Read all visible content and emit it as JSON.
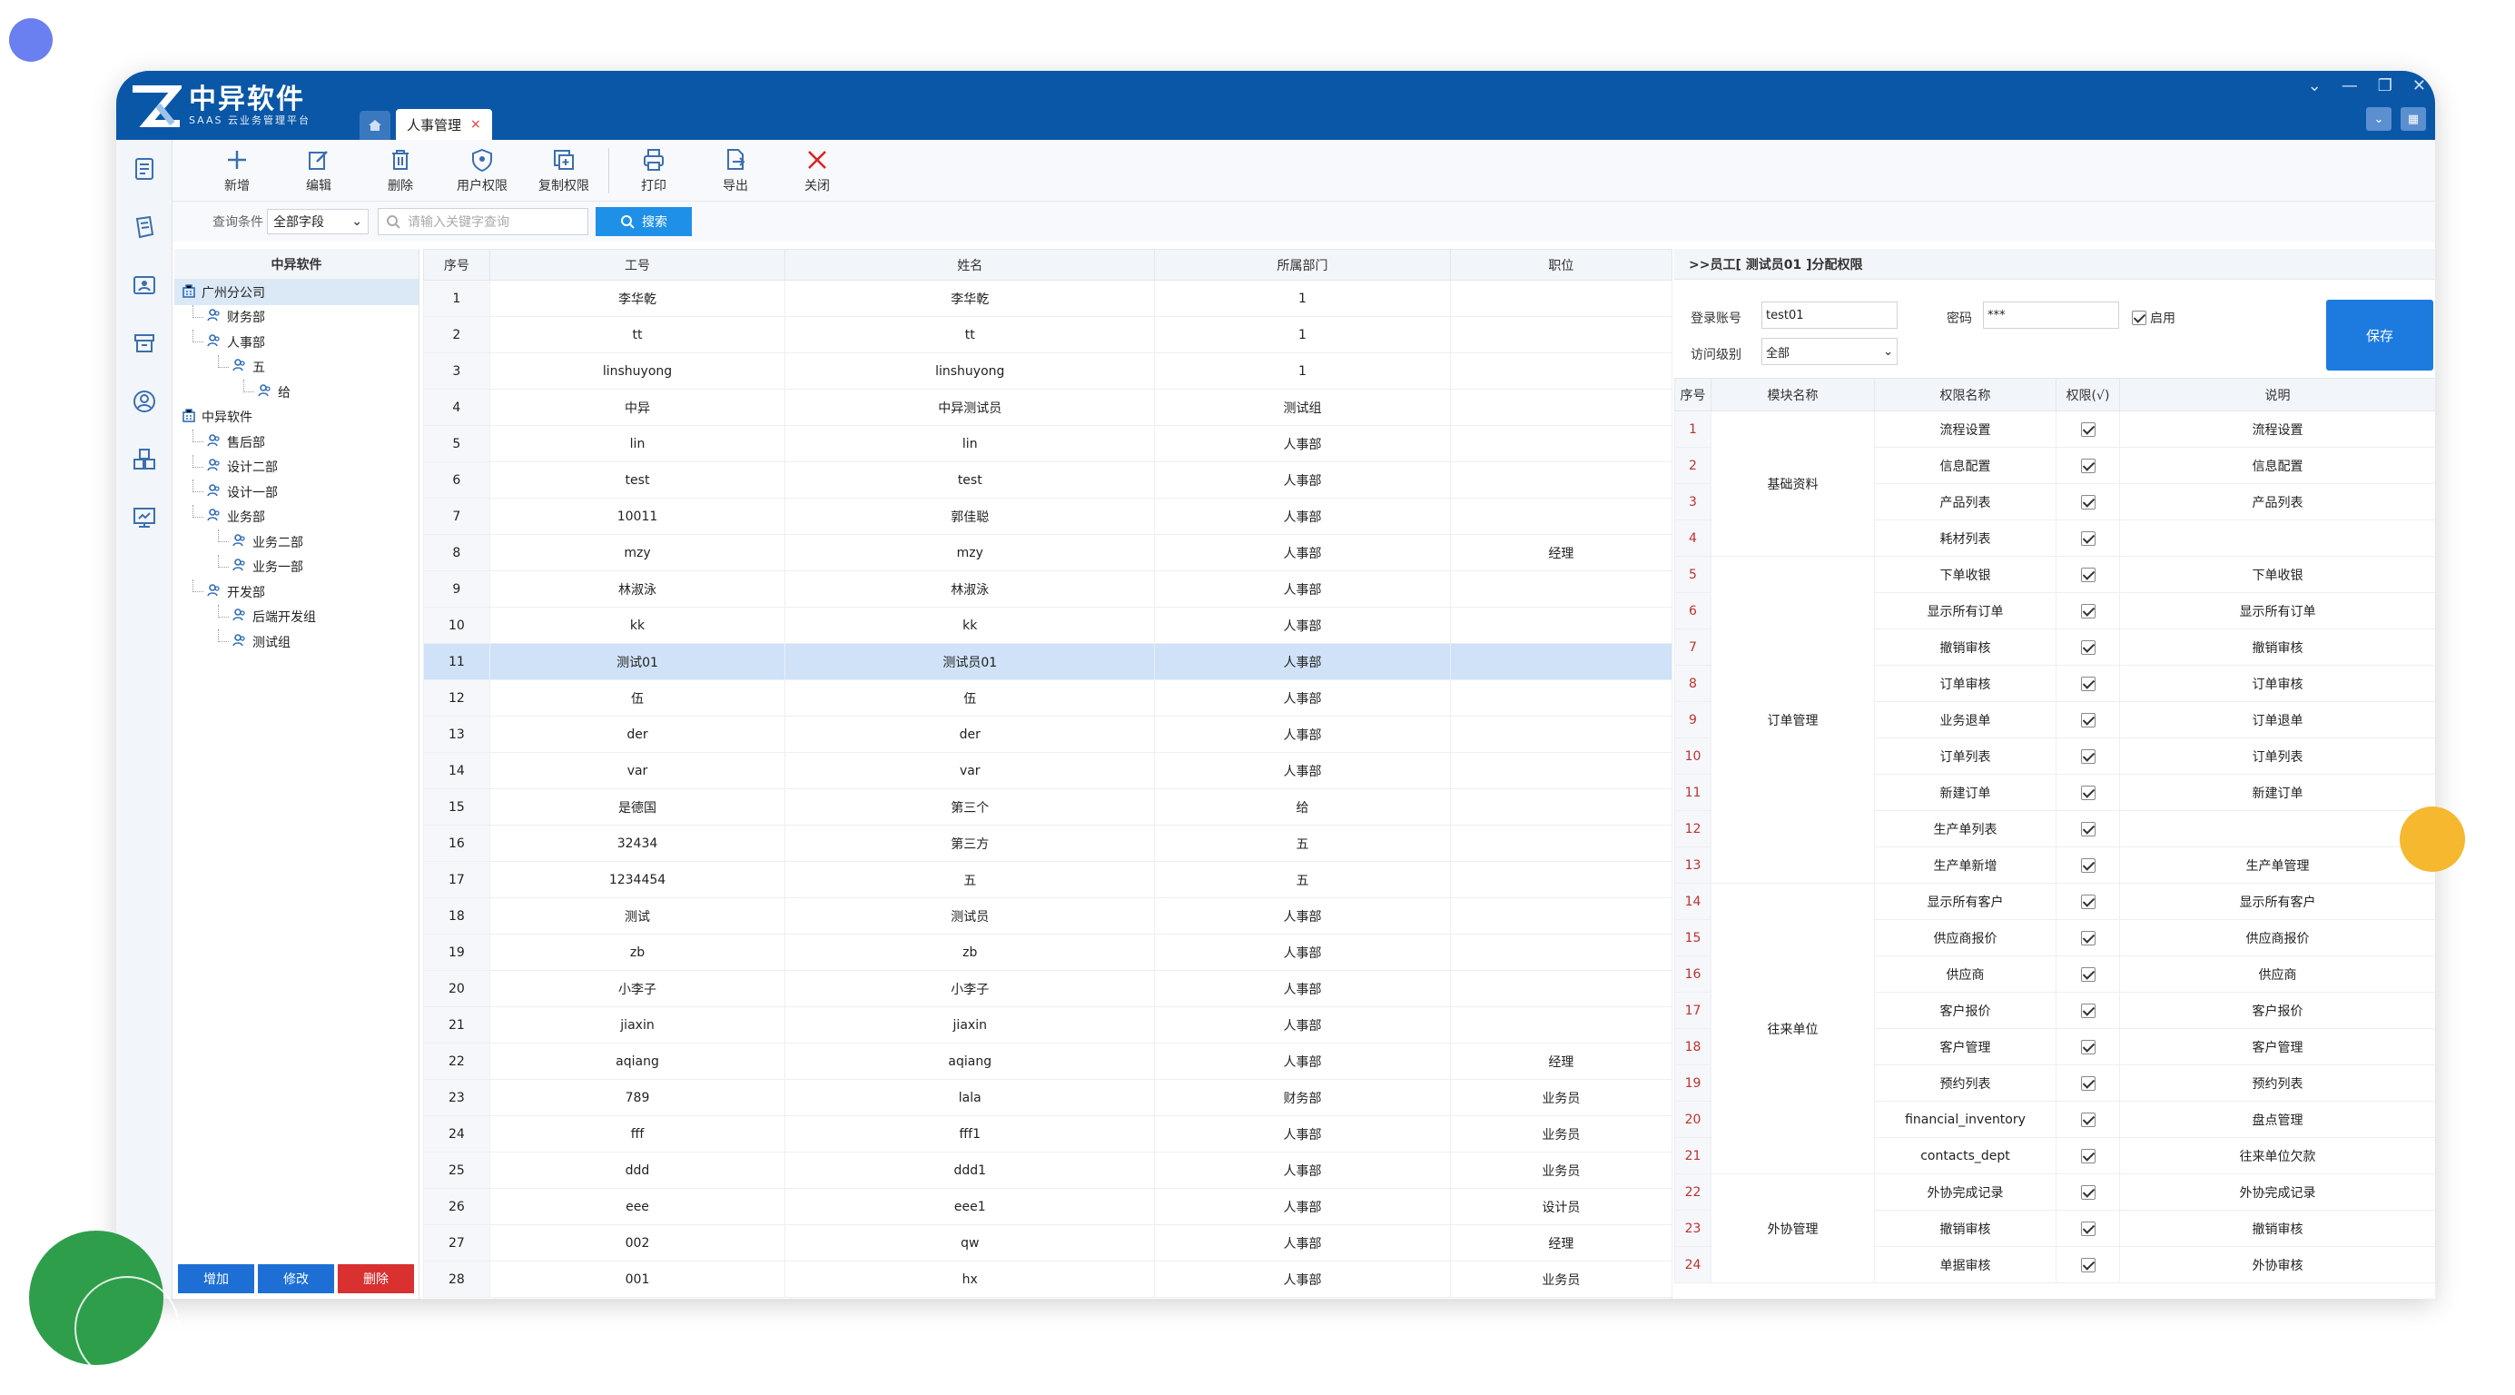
{
  "app": {
    "logo_title": "中异软件",
    "logo_subtitle": "SAAS 云业务管理平台",
    "active_tab": "人事管理",
    "tab_close": "×"
  },
  "colors": {
    "titlebar": "#0a57a8",
    "accent": "#1f90e8",
    "save": "#1d7be0",
    "add": "#1d6fd6",
    "delete": "#d93030"
  },
  "toolbar": [
    {
      "label": "新增",
      "icon": "plus-icon"
    },
    {
      "label": "编辑",
      "icon": "edit-icon"
    },
    {
      "label": "删除",
      "icon": "trash-icon"
    },
    {
      "label": "用户权限",
      "icon": "shield-icon"
    },
    {
      "label": "复制权限",
      "icon": "copy-icon"
    },
    {
      "label": "打印",
      "icon": "printer-icon"
    },
    {
      "label": "导出",
      "icon": "export-icon"
    },
    {
      "label": "关闭",
      "icon": "close-icon"
    }
  ],
  "query": {
    "label": "查询条件",
    "field": "全部字段",
    "placeholder": "请输入关键字查询",
    "search": "搜索"
  },
  "tree": {
    "title": "中异软件",
    "nodes": [
      {
        "label": "广州分公司",
        "level": 0,
        "type": "org",
        "selected": true
      },
      {
        "label": "财务部",
        "level": 1,
        "type": "dept"
      },
      {
        "label": "人事部",
        "level": 1,
        "type": "dept"
      },
      {
        "label": "五",
        "level": 2,
        "type": "dept"
      },
      {
        "label": "给",
        "level": 3,
        "type": "dept"
      },
      {
        "label": "中异软件",
        "level": 0,
        "type": "org"
      },
      {
        "label": "售后部",
        "level": 1,
        "type": "dept"
      },
      {
        "label": "设计二部",
        "level": 1,
        "type": "dept"
      },
      {
        "label": "设计一部",
        "level": 1,
        "type": "dept"
      },
      {
        "label": "业务部",
        "level": 1,
        "type": "dept"
      },
      {
        "label": "业务二部",
        "level": 2,
        "type": "dept"
      },
      {
        "label": "业务一部",
        "level": 2,
        "type": "dept"
      },
      {
        "label": "开发部",
        "level": 1,
        "type": "dept"
      },
      {
        "label": "后端开发组",
        "level": 2,
        "type": "dept"
      },
      {
        "label": "测试组",
        "level": 2,
        "type": "dept"
      }
    ],
    "buttons": {
      "add": "增加",
      "edit": "修改",
      "delete": "删除"
    }
  },
  "grid": {
    "columns": [
      "序号",
      "工号",
      "姓名",
      "所属部门",
      "职位"
    ],
    "selected_row": 11,
    "rows": [
      [
        "1",
        "李华乾",
        "李华乾",
        "1",
        ""
      ],
      [
        "2",
        "tt",
        "tt",
        "1",
        ""
      ],
      [
        "3",
        "linshuyong",
        "linshuyong",
        "1",
        ""
      ],
      [
        "4",
        "中异",
        "中异测试员",
        "测试组",
        ""
      ],
      [
        "5",
        "lin",
        "lin",
        "人事部",
        ""
      ],
      [
        "6",
        "test",
        "test",
        "人事部",
        ""
      ],
      [
        "7",
        "10011",
        "郭佳聪",
        "人事部",
        ""
      ],
      [
        "8",
        "mzy",
        "mzy",
        "人事部",
        "经理"
      ],
      [
        "9",
        "林淑泳",
        "林淑泳",
        "人事部",
        ""
      ],
      [
        "10",
        "kk",
        "kk",
        "人事部",
        ""
      ],
      [
        "11",
        "测试01",
        "测试员01",
        "人事部",
        ""
      ],
      [
        "12",
        "伍",
        "伍",
        "人事部",
        ""
      ],
      [
        "13",
        "der",
        "der",
        "人事部",
        ""
      ],
      [
        "14",
        "var",
        "var",
        "人事部",
        ""
      ],
      [
        "15",
        "是德国",
        "第三个",
        "给",
        ""
      ],
      [
        "16",
        "32434",
        "第三方",
        "五",
        ""
      ],
      [
        "17",
        "1234454",
        "五",
        "五",
        ""
      ],
      [
        "18",
        "测试",
        "测试员",
        "人事部",
        ""
      ],
      [
        "19",
        "zb",
        "zb",
        "人事部",
        ""
      ],
      [
        "20",
        "小李子",
        "小李子",
        "人事部",
        ""
      ],
      [
        "21",
        "jiaxin",
        "jiaxin",
        "人事部",
        ""
      ],
      [
        "22",
        "aqiang",
        "aqiang",
        "人事部",
        "经理"
      ],
      [
        "23",
        "789",
        "lala",
        "财务部",
        "业务员"
      ],
      [
        "24",
        "fff",
        "fff1",
        "人事部",
        "业务员"
      ],
      [
        "25",
        "ddd",
        "ddd1",
        "人事部",
        "业务员"
      ],
      [
        "26",
        "eee",
        "eee1",
        "人事部",
        "设计员"
      ],
      [
        "27",
        "002",
        "qw",
        "人事部",
        "经理"
      ],
      [
        "28",
        "001",
        "hx",
        "人事部",
        "业务员"
      ]
    ]
  },
  "perm": {
    "header": ">>员工[ 测试员01 ]分配权限",
    "login_label": "登录账号",
    "login_value": "test01",
    "pwd_label": "密码",
    "pwd_value": "***",
    "enable_label": "启用",
    "level_label": "访问级别",
    "level_value": "全部",
    "save": "保存",
    "columns": [
      "序号",
      "模块名称",
      "权限名称",
      "权限(√)",
      "说明"
    ],
    "groups": [
      {
        "module": "基础资料",
        "rows": [
          [
            "1",
            "流程设置",
            "流程设置"
          ],
          [
            "2",
            "信息配置",
            "信息配置"
          ],
          [
            "3",
            "产品列表",
            "产品列表"
          ],
          [
            "4",
            "耗材列表",
            ""
          ]
        ]
      },
      {
        "module": "订单管理",
        "rows": [
          [
            "5",
            "下单收银",
            "下单收银"
          ],
          [
            "6",
            "显示所有订单",
            "显示所有订单"
          ],
          [
            "7",
            "撤销审核",
            "撤销审核"
          ],
          [
            "8",
            "订单审核",
            "订单审核"
          ],
          [
            "9",
            "业务退单",
            "订单退单"
          ],
          [
            "10",
            "订单列表",
            "订单列表"
          ],
          [
            "11",
            "新建订单",
            "新建订单"
          ],
          [
            "12",
            "生产单列表",
            ""
          ],
          [
            "13",
            "生产单新增",
            "生产单管理"
          ]
        ]
      },
      {
        "module": "往来单位",
        "rows": [
          [
            "14",
            "显示所有客户",
            "显示所有客户"
          ],
          [
            "15",
            "供应商报价",
            "供应商报价"
          ],
          [
            "16",
            "供应商",
            "供应商"
          ],
          [
            "17",
            "客户报价",
            "客户报价"
          ],
          [
            "18",
            "客户管理",
            "客户管理"
          ],
          [
            "19",
            "预约列表",
            "预约列表"
          ],
          [
            "20",
            "financial_inventory",
            "盘点管理"
          ],
          [
            "21",
            "contacts_dept",
            "往来单位欠款"
          ]
        ]
      },
      {
        "module": "外协管理",
        "rows": [
          [
            "22",
            "外协完成记录",
            "外协完成记录"
          ],
          [
            "23",
            "撤销审核",
            "撤销审核"
          ],
          [
            "24",
            "单据审核",
            "外协审核"
          ]
        ]
      }
    ]
  }
}
